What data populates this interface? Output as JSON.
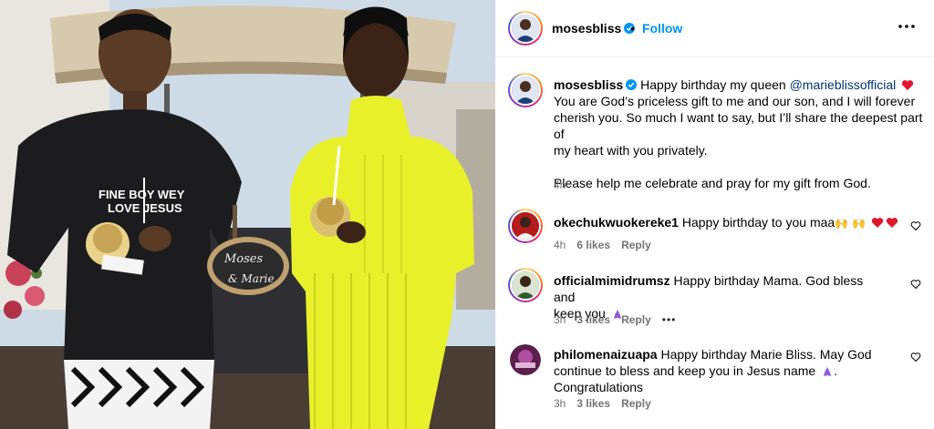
{
  "post": {
    "username": "mosesbliss",
    "follow_label": "Follow",
    "separator": "•",
    "caption": {
      "username": "mosesbliss",
      "prefix": "Happy birthday my queen",
      "mention": "@marieblissofficial",
      "line2": "You are God’s priceless gift to me and our son, and I will forever",
      "line3": "cherish you. So much I want to say, but I’ll share the deepest part of",
      "line4": "my heart with you privately.",
      "line5": "Please help me celebrate and pray for my gift from God.",
      "time": "4h"
    },
    "photo_text": {
      "shirt_line1": "FINE BOY WEY",
      "shirt_line2": "LOVE JESUS",
      "sign_line1": "Moses",
      "sign_line2": "& Marie"
    }
  },
  "comments": [
    {
      "username": "okechukwuokereke1",
      "text": "Happy birthday to you maa",
      "emoji": "🙌 🙌",
      "time": "4h",
      "likes": "6 likes",
      "reply": "Reply"
    },
    {
      "username": "officialmimidrumsz",
      "text": "Happy birthday Mama. God bless and",
      "text_line2": "keep you",
      "time": "3h",
      "likes": "3 likes",
      "reply": "Reply",
      "more": "•••"
    },
    {
      "username": "philomenaizuapa",
      "text": "Happy birthday Marie Bliss. May God",
      "text_line2": "continue to bless and keep you in Jesus name",
      "text_line3": "Congratulations",
      "time": "3h",
      "likes": "3 likes",
      "reply": "Reply"
    }
  ],
  "colors": {
    "accent": "#0095f6",
    "heart": "#e0162b",
    "secondary_text": "#737373",
    "mention": "#00376b"
  }
}
